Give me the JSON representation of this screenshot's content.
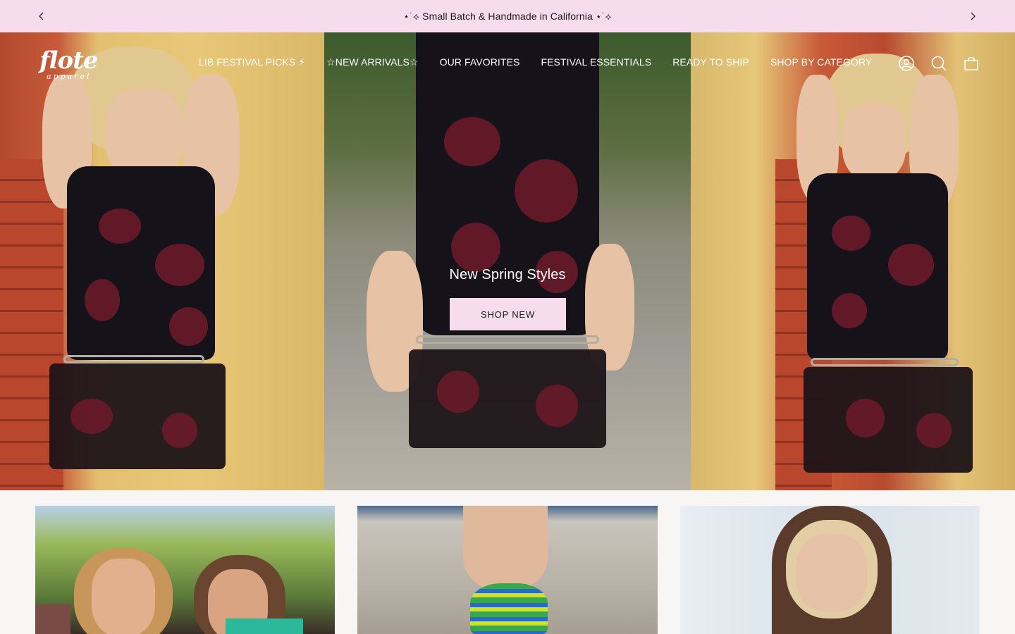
{
  "announcement": {
    "text": "⋆˙⟡ Small Batch & Handmade in California ⋆˙⟡",
    "prev_icon": "chevron-left-icon",
    "next_icon": "chevron-right-icon"
  },
  "header": {
    "logo": {
      "main": "flote",
      "sub": "apparel"
    },
    "nav": [
      {
        "label": "LIB FESTIVAL PICKS ⚡︎"
      },
      {
        "label": "☆NEW ARRIVALS☆"
      },
      {
        "label": "OUR FAVORITES"
      },
      {
        "label": "FESTIVAL ESSENTIALS"
      },
      {
        "label": "READY TO SHIP"
      },
      {
        "label": "SHOP BY CATEGORY"
      }
    ],
    "icons": [
      "account-icon",
      "search-icon",
      "cart-icon"
    ]
  },
  "hero": {
    "title": "New Spring Styles",
    "button_label": "SHOP NEW"
  },
  "colors": {
    "announcement_bg": "#f6dcec",
    "button_bg": "#f6dcec",
    "page_bg": "#f8f6f4",
    "text_dark": "#1c1c1c"
  }
}
